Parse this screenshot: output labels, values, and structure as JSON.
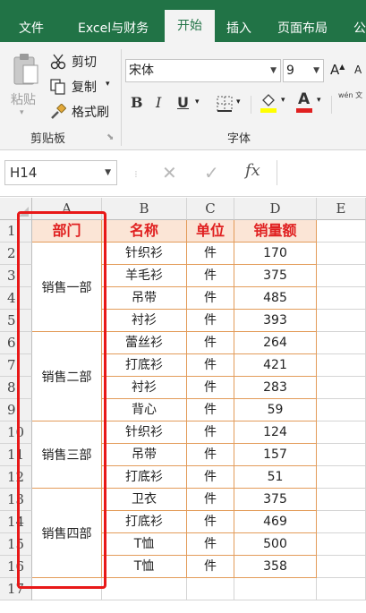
{
  "ribbon_tabs": [
    "文件",
    "Excel与财务",
    "开始",
    "插入",
    "页面布局",
    "公"
  ],
  "active_tab": "开始",
  "clipboard": {
    "paste_label": "粘贴",
    "cut_label": "剪切",
    "copy_label": "复制",
    "format_painter_label": "格式刷",
    "group_label": "剪贴板"
  },
  "font": {
    "font_name": "宋体",
    "font_size": "9",
    "group_label": "字体",
    "grow_label": "A",
    "shrink_label": "A",
    "bold": "B",
    "italic": "I",
    "underline": "U",
    "font_color_letter": "A",
    "phonetic_label": "wén 文"
  },
  "formula_bar": {
    "name_box": "H14",
    "fx_label": "fx",
    "cancel_icon": "✕",
    "enter_icon": "✓"
  },
  "columns": [
    "A",
    "B",
    "C",
    "D",
    "E"
  ],
  "rows": [
    "1",
    "2",
    "3",
    "4",
    "5",
    "6",
    "7",
    "8",
    "9",
    "10",
    "11",
    "12",
    "13",
    "14",
    "15",
    "16",
    "17"
  ],
  "table": {
    "headers": [
      "部门",
      "名称",
      "单位",
      "销量额"
    ],
    "departments": [
      {
        "name": "销售一部",
        "span": 4
      },
      {
        "name": "销售二部",
        "span": 4
      },
      {
        "name": "销售三部",
        "span": 3
      },
      {
        "name": "销售四部",
        "span": 4
      }
    ],
    "rows": [
      [
        "针织衫",
        "件",
        "170"
      ],
      [
        "羊毛衫",
        "件",
        "375"
      ],
      [
        "吊带",
        "件",
        "485"
      ],
      [
        "衬衫",
        "件",
        "393"
      ],
      [
        "蕾丝衫",
        "件",
        "264"
      ],
      [
        "打底衫",
        "件",
        "421"
      ],
      [
        "衬衫",
        "件",
        "283"
      ],
      [
        "背心",
        "件",
        "59"
      ],
      [
        "针织衫",
        "件",
        "124"
      ],
      [
        "吊带",
        "件",
        "157"
      ],
      [
        "打底衫",
        "件",
        "51"
      ],
      [
        "卫衣",
        "件",
        "375"
      ],
      [
        "打底衫",
        "件",
        "469"
      ],
      [
        "T恤",
        "件",
        "500"
      ],
      [
        "T恤",
        "件",
        "358"
      ]
    ]
  },
  "colors": {
    "excel_green": "#217346",
    "header_fill": "#fbe5d6",
    "header_text": "#e02020",
    "annotation_red": "#e81818"
  }
}
